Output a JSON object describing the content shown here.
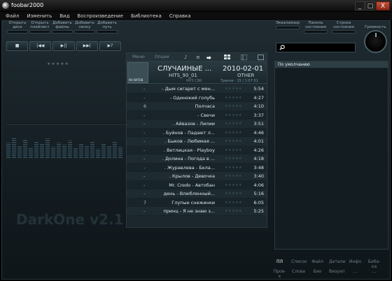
{
  "window": {
    "title": "foobar2000",
    "min_label": "_",
    "max_label": "□",
    "close_label": "X"
  },
  "menu": [
    "Файл",
    "Изменить",
    "Вид",
    "Воспроизведение",
    "Библиотека",
    "Справка"
  ],
  "toolbar": {
    "left": [
      {
        "line1": "Открыть",
        "line2": "диск"
      },
      {
        "line1": "Открыть",
        "line2": "плейлист"
      },
      {
        "line1": "Добавить",
        "line2": "файлы"
      },
      {
        "line1": "Добавить",
        "line2": "папку"
      },
      {
        "line1": "Добавить",
        "line2": "путь"
      }
    ],
    "right": [
      {
        "line1": "Эквалайзер",
        "line2": ""
      },
      {
        "line1": "Панель",
        "line2": "состояния"
      },
      {
        "line1": "Строка",
        "line2": "состояния"
      }
    ]
  },
  "transport": [
    "■",
    "|◀◀",
    "▶||",
    "▶▶|",
    "▶?"
  ],
  "volume": {
    "label": "Громкость"
  },
  "search": {
    "placeholder": "",
    "value": ""
  },
  "rating_empty": "★★★★★",
  "center": {
    "tabs": [
      "Меню",
      "Опции"
    ],
    "icons": {
      "note": "♪",
      "list": "≡",
      "arrow": "⮕"
    },
    "now_playing": {
      "title": "СЛУЧАЙНЫЕ ...",
      "subtitle": "HITS_90_01",
      "format": "MP3 CBR",
      "date": "2010-02-01",
      "genre": "OTHER",
      "tracks_info": "Треков - 15 | 1:07:51",
      "art_label": "90 ХИТОВ"
    },
    "tracks": [
      {
        "num": "-",
        "title": "- Дым сигарет с мен...",
        "rating": "★★★★★",
        "duration": "5:54"
      },
      {
        "num": "-",
        "title": "- Одинокий голубь",
        "rating": "★★★★★",
        "duration": "4:27"
      },
      {
        "num": "6",
        "title": "Полчаса",
        "rating": "★★★★★",
        "duration": "4:10"
      },
      {
        "num": "-",
        "title": "- Свечи",
        "rating": "★★★★★",
        "duration": "3:37"
      },
      {
        "num": "-",
        "title": ". Айвазов - Лилии",
        "rating": "★★★★★",
        "duration": "3:51"
      },
      {
        "num": "-",
        "title": ". Буйнов - Падают л...",
        "rating": "★★★★★",
        "duration": "4:46"
      },
      {
        "num": "-",
        "title": ". Быков - Любимая ...",
        "rating": "★★★★★",
        "duration": "4:01"
      },
      {
        "num": "-",
        "title": ". Ветлицкая - Playboy",
        "rating": "★★★★★",
        "duration": "4:26"
      },
      {
        "num": "-",
        "title": ". Долина - Погода в ...",
        "rating": "★★★★★",
        "duration": "4:18"
      },
      {
        "num": "-",
        "title": ". Журавлева - Бела...",
        "rating": "★★★★★",
        "duration": "3:48"
      },
      {
        "num": "-",
        "title": ". Крылов - Девочка",
        "rating": "★★★★★",
        "duration": "3:40"
      },
      {
        "num": "-",
        "title": "Mr. Credo - Автобан",
        "rating": "★★★★★",
        "duration": "4:06"
      },
      {
        "num": "-",
        "title": "день - Влюбленный...",
        "rating": "★★★★★",
        "duration": "5:16"
      },
      {
        "num": "7",
        "title": "Глупые снежинки",
        "rating": "★★★★★",
        "duration": "6:05"
      },
      {
        "num": "-",
        "title": "принц - Я не знаю з...",
        "rating": "★★★★★",
        "duration": "5:25"
      }
    ]
  },
  "watermark": "DarkOne v2.1",
  "right_panel": {
    "preset": "По умолчанию"
  },
  "bottom_buttons": {
    "row1": [
      "ПЛ",
      "Список",
      "Файл",
      "Детали",
      "Инфо",
      "Биба-ка"
    ],
    "row2": [
      "Пров-к",
      "Слова",
      "Био",
      "Визуал",
      "...",
      "..."
    ]
  }
}
